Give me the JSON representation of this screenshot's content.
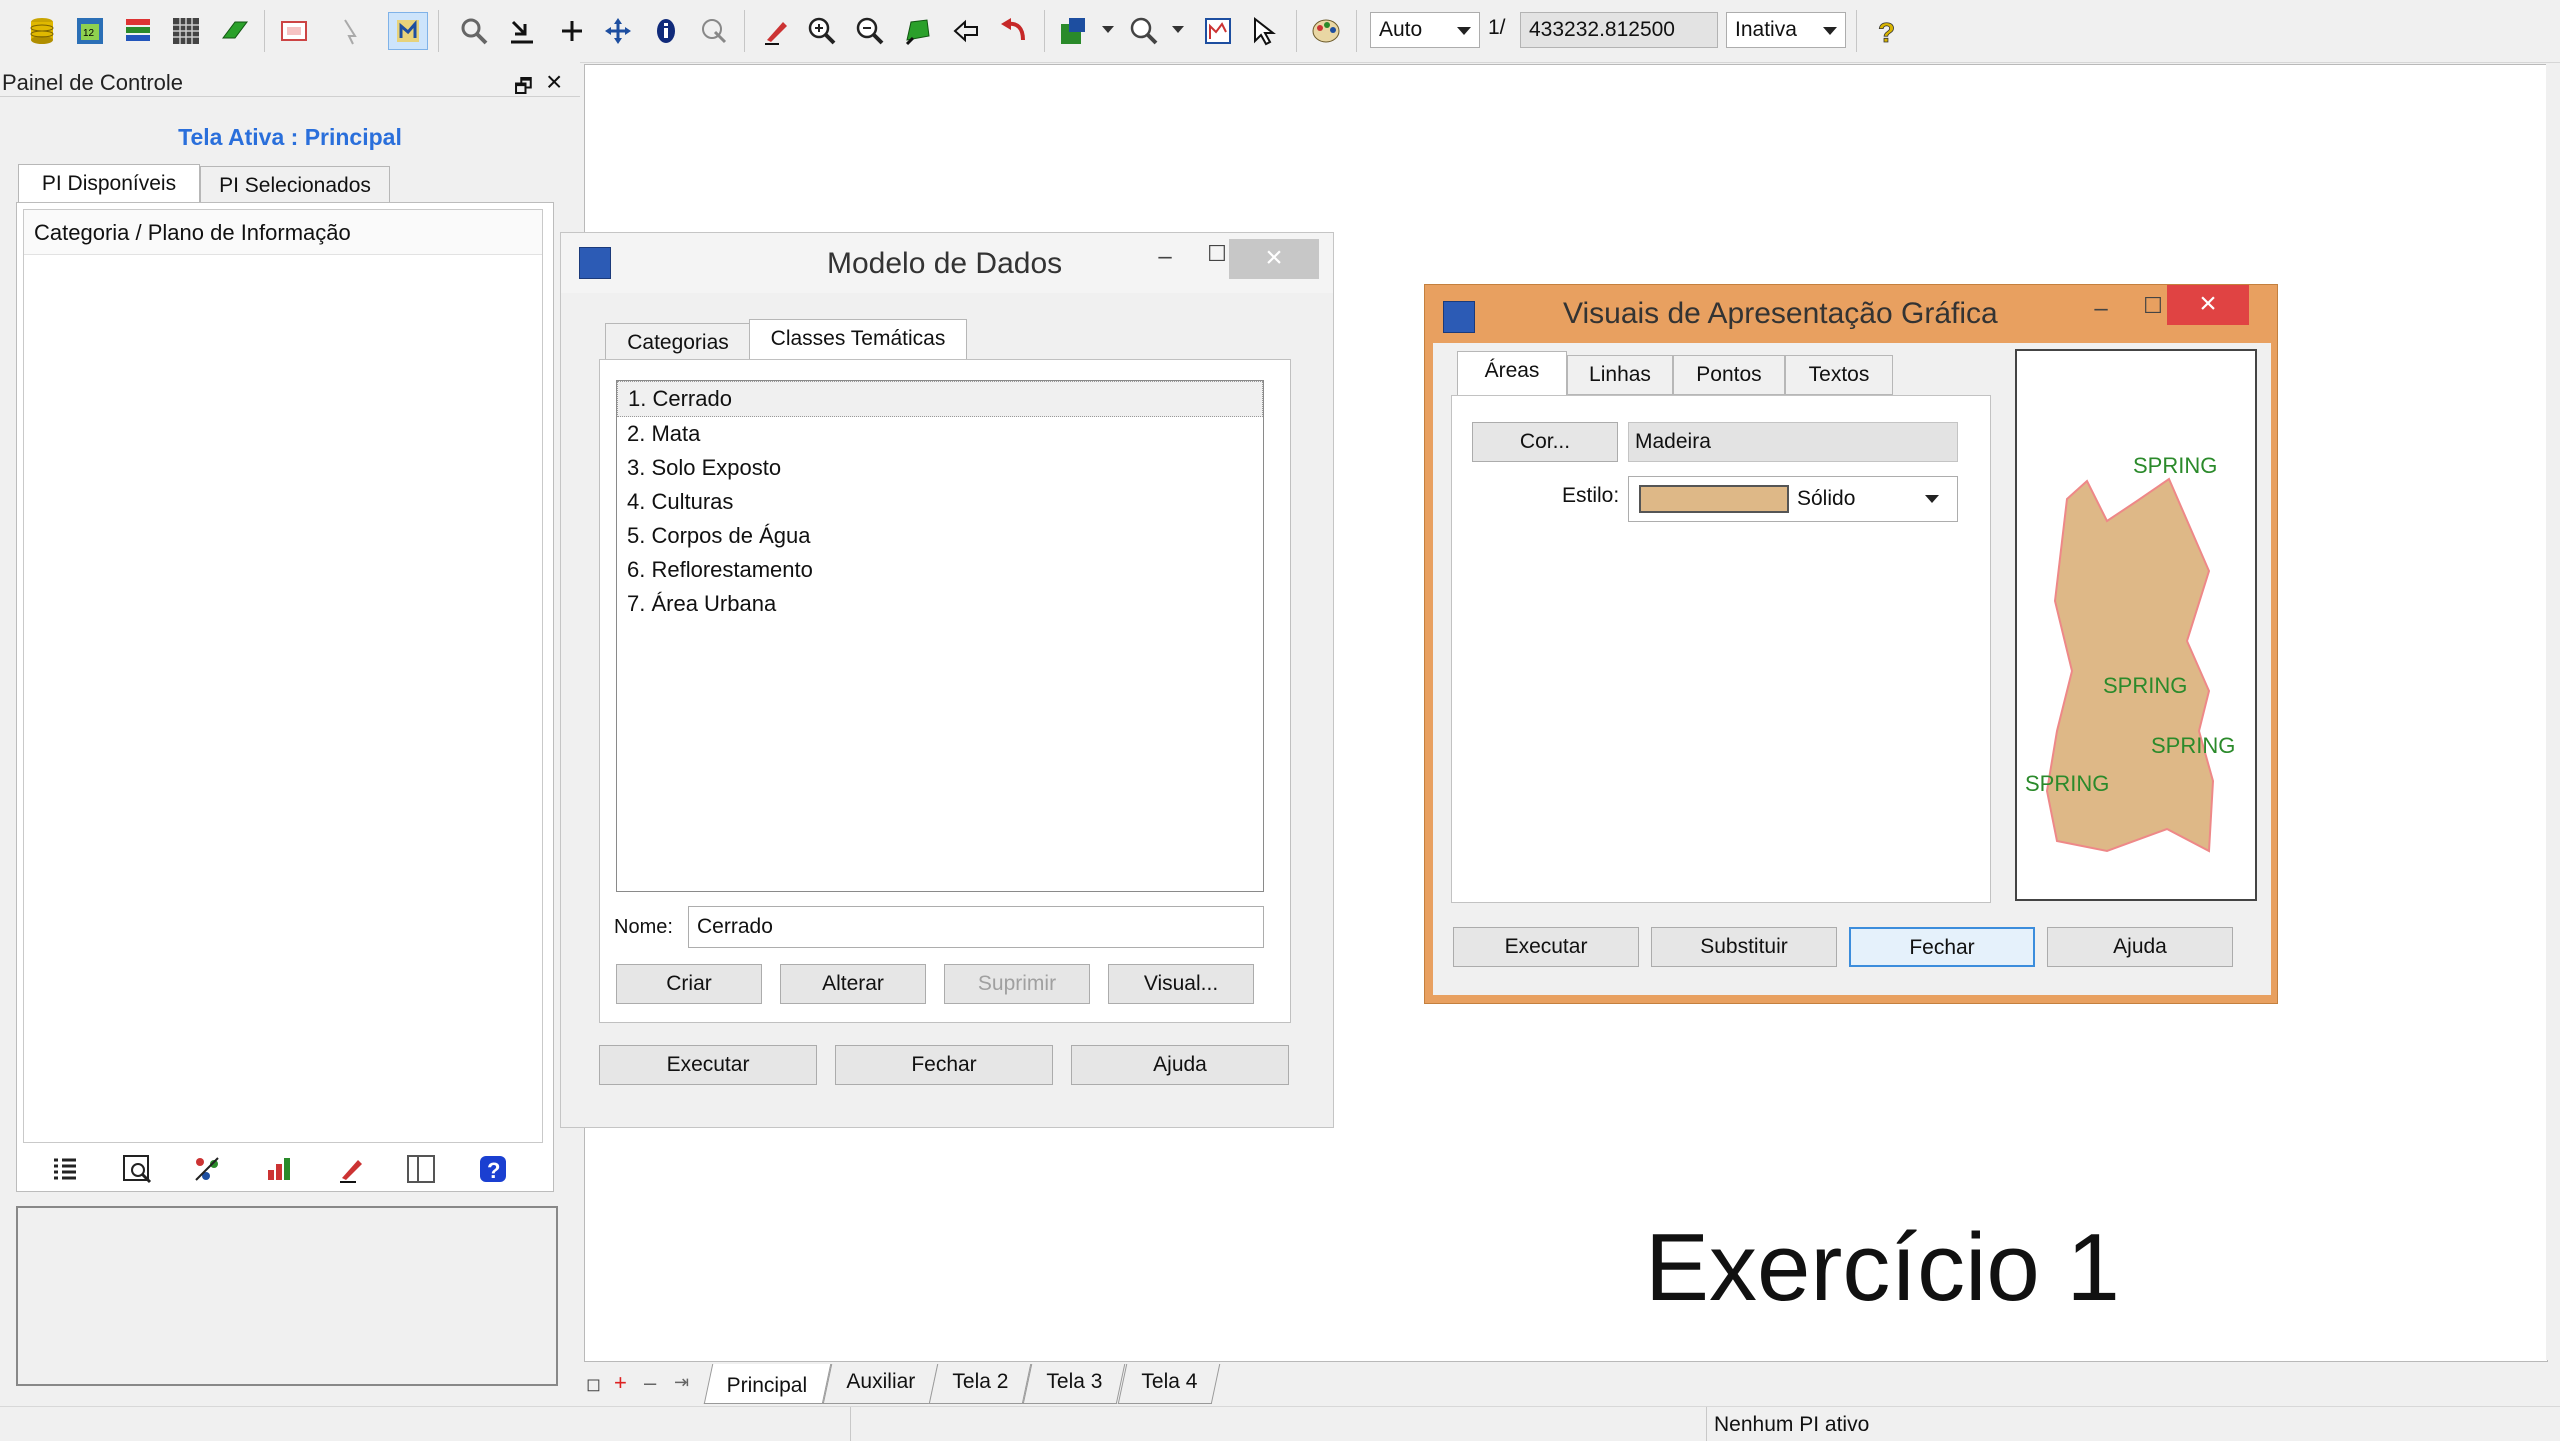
{
  "toolbar": {
    "scale_mode": "Auto",
    "scale_prefix": "1/",
    "scale_value": "433232.812500",
    "status_select": "Inativa"
  },
  "left_panel": {
    "title": "Painel de Controle",
    "active_screen": "Tela Ativa : Principal",
    "tabs": [
      "PI Disponíveis",
      "PI Selecionados"
    ],
    "tree_header": "Categoria / Plano de Informação"
  },
  "modelo_dialog": {
    "title": "Modelo de Dados",
    "tabs": [
      "Categorias",
      "Classes Temáticas"
    ],
    "classes": [
      "1. Cerrado",
      "2. Mata",
      "3. Solo Exposto",
      "4. Culturas",
      "5. Corpos de Água",
      "6. Reflorestamento",
      "7. Área Urbana"
    ],
    "name_label": "Nome:",
    "name_value": "Cerrado",
    "buttons": [
      "Criar",
      "Alterar",
      "Suprimir",
      "Visual..."
    ],
    "footer_buttons": [
      "Executar",
      "Fechar",
      "Ajuda"
    ]
  },
  "visual_dialog": {
    "title": "Visuais de Apresentação Gráfica",
    "tabs": [
      "Áreas",
      "Linhas",
      "Pontos",
      "Textos"
    ],
    "color_button": "Cor...",
    "color_name": "Madeira",
    "style_label": "Estilo:",
    "style_value": "Sólido",
    "swatch_color": "#deb887",
    "preview_labels": [
      "SPRING",
      "SPRING",
      "SPRING",
      "SPRING"
    ],
    "footer_buttons": [
      "Executar",
      "Substituir",
      "Fechar",
      "Ajuda"
    ],
    "accent_color": "#e8a060"
  },
  "canvas": {
    "overlay_text": "Exercício 1"
  },
  "bottom": {
    "screen_tabs": [
      "Principal",
      "Auxiliar",
      "Tela 2",
      "Tela 3",
      "Tela 4"
    ],
    "status": "Nenhum PI ativo"
  }
}
